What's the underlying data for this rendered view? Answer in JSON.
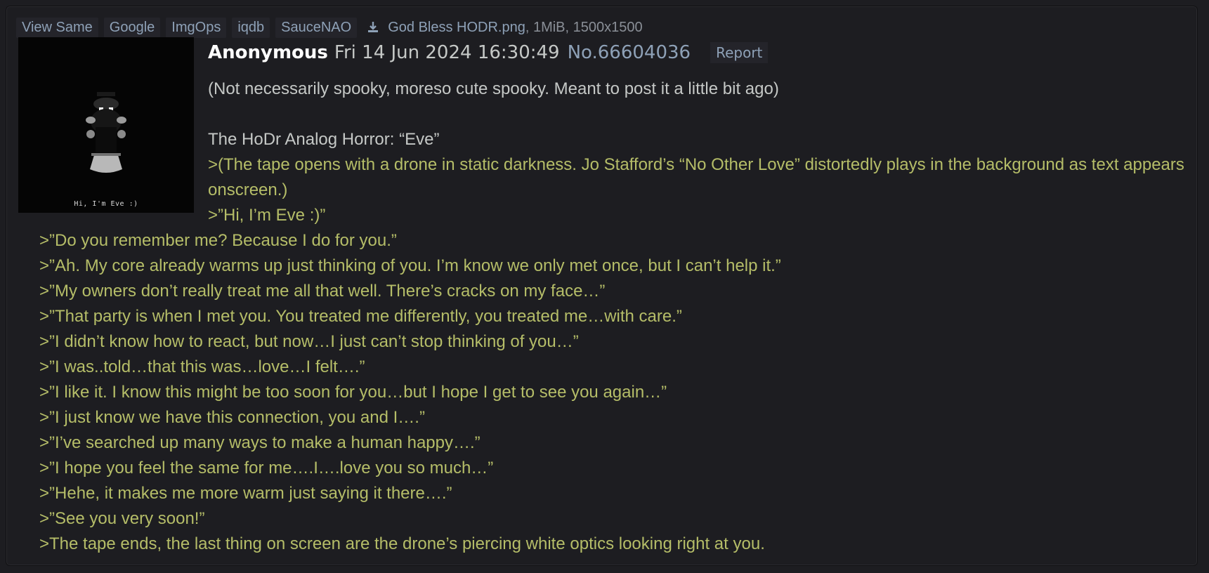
{
  "file_bar": {
    "tools": [
      "View Same",
      "Google",
      "ImgOps",
      "iqdb",
      "SauceNAO"
    ],
    "download_icon": "download-icon",
    "filename": "God Bless HODR.png",
    "meta": ", 1MiB, 1500x1500"
  },
  "thumbnail": {
    "caption": "Hi, I'm Eve :)"
  },
  "post": {
    "name": "Anonymous",
    "date": "Fri 14 Jun 2024 16:30:49",
    "number": "No.66604036",
    "report": "Report",
    "intro": "(Not necessarily spooky, moreso cute spooky. Meant to post it a little bit ago)",
    "title": "The HoDr Analog Horror: “Eve”",
    "quotes": [
      ">(The tape opens with a drone in static darkness. Jo Stafford’s “No Other Love” distortedly plays in the background as text appears onscreen.)",
      ">”Hi, I’m Eve :)”",
      ">”Do you remember me? Because I do for you.”",
      ">”Ah. My core already warms up just thinking of you. I’m know we only met once, but I can’t help it.”",
      ">”My owners don’t really treat me all that well. There’s cracks on my face…”",
      ">”That party is when I met you. You treated me differently, you treated me…with care.”",
      ">”I didn’t know how to react, but now…I just can’t stop thinking of you…”",
      ">”I was..told…that this was…love…I felt….”",
      ">”I like it. I know this might be too soon for you…but I hope I get to see you again…”",
      ">”I just know we have this connection, you and I….”",
      ">”I’ve searched up many ways to make a human happy….”",
      ">”I hope you feel the same for me….I….love you so much…”",
      ">”Hehe, it makes me more warm just saying it there….”",
      ">”See you very soon!”",
      ">The tape ends, the last thing on screen are the drone’s piercing white optics looking right at you."
    ]
  },
  "colors": {
    "background": "#1d1d21",
    "link": "#8ea1b7",
    "greentext": "#b5bd68",
    "text": "#c5c8c6"
  }
}
